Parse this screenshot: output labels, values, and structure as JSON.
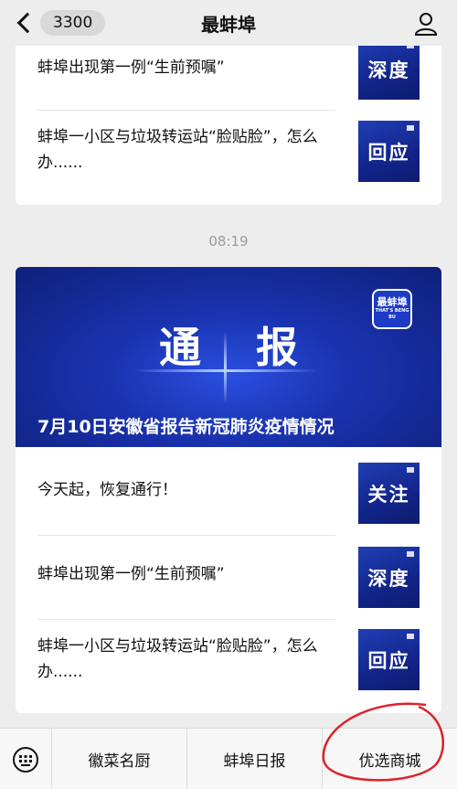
{
  "header": {
    "back_count": "3300",
    "title": "最蚌埠"
  },
  "top_card": {
    "items": [
      {
        "text": "蚌埠出现第一例“生前预嘱”",
        "thumb": "深度"
      },
      {
        "text": "蚌埠一小区与垃圾转运站“脸贴脸”，怎么办......",
        "thumb": "回应"
      }
    ]
  },
  "timestamp": "08:19",
  "main_card": {
    "banner_title": "通报",
    "banner_caption": "7月10日安徽省报告新冠肺炎疫情情况",
    "logo_text": "最蚌埠",
    "logo_subtext": "THAT'S BENG BU",
    "items": [
      {
        "text": "今天起，恢复通行！",
        "thumb": "关注"
      },
      {
        "text": "蚌埠出现第一例“生前预嘱”",
        "thumb": "深度"
      },
      {
        "text": "蚌埠一小区与垃圾转运站“脸贴脸”，怎么办......",
        "thumb": "回应"
      }
    ]
  },
  "menu": {
    "tabs": [
      "徽菜名厨",
      "蚌埠日报",
      "优选商城"
    ]
  },
  "colors": {
    "accent_blue": "#1a33b0",
    "highlight_red": "#e0202a"
  }
}
